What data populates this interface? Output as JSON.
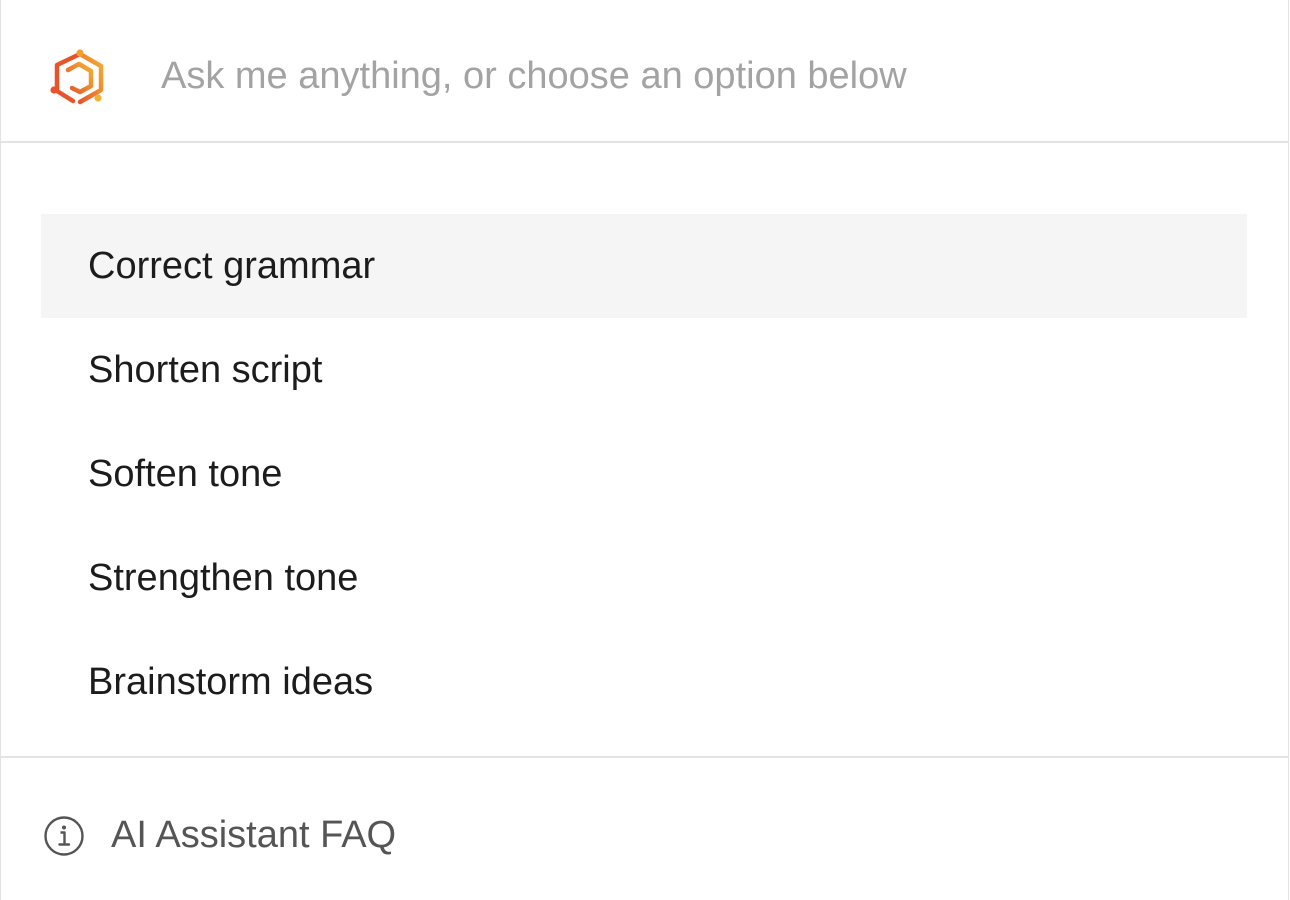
{
  "prompt": {
    "placeholder": "Ask me anything, or choose an option below",
    "value": ""
  },
  "options": [
    {
      "label": "Correct grammar",
      "active": true
    },
    {
      "label": "Shorten script",
      "active": false
    },
    {
      "label": "Soften tone",
      "active": false
    },
    {
      "label": "Strengthen tone",
      "active": false
    },
    {
      "label": "Brainstorm ideas",
      "active": false
    }
  ],
  "footer": {
    "faq_label": "AI Assistant FAQ",
    "icon": "info-icon"
  },
  "colors": {
    "brand_primary": "#e8542a",
    "brand_secondary": "#f2b233",
    "highlight_bg": "#f5f5f5",
    "placeholder_text": "#a3a3a3",
    "divider": "#e3e3e3"
  }
}
